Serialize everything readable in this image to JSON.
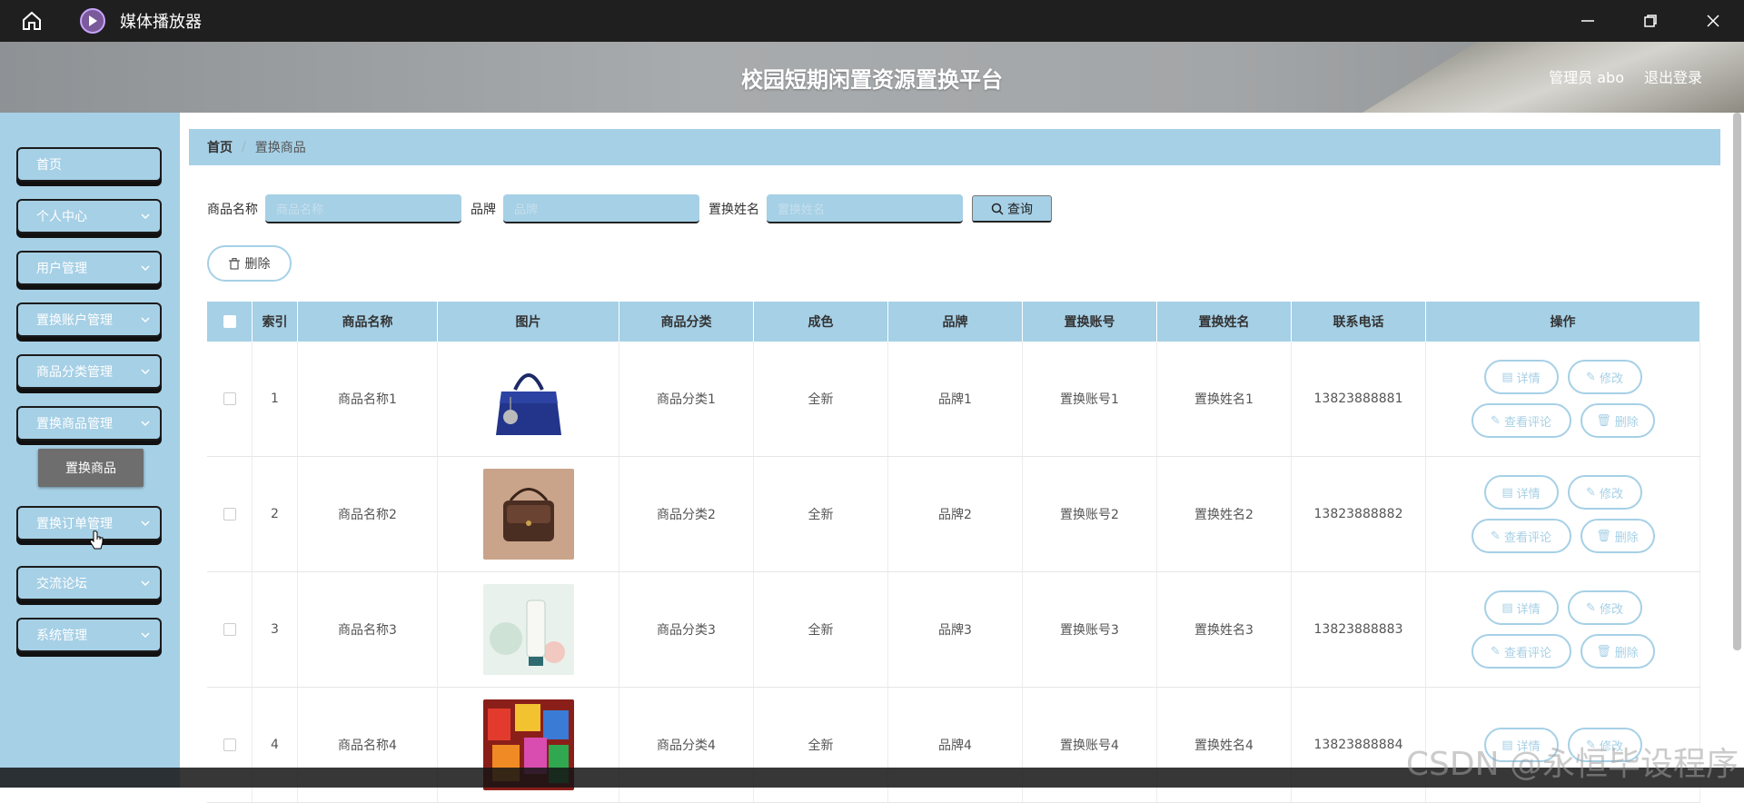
{
  "player": {
    "title": "媒体播放器"
  },
  "header": {
    "site_title": "校园短期闲置资源置换平台",
    "user_label": "管理员 abo",
    "logout_label": "退出登录"
  },
  "sidebar": {
    "items": [
      {
        "label": "首页"
      },
      {
        "label": "个人中心"
      },
      {
        "label": "用户管理"
      },
      {
        "label": "置换账户管理"
      },
      {
        "label": "商品分类管理"
      },
      {
        "label": "置换商品管理"
      },
      {
        "label": "置换订单管理"
      },
      {
        "label": "交流论坛"
      },
      {
        "label": "系统管理"
      }
    ],
    "active_sub": "置换商品"
  },
  "breadcrumb": {
    "home": "首页",
    "separator": "/",
    "current": "置换商品"
  },
  "search": {
    "name_label": "商品名称",
    "name_placeholder": "商品名称",
    "brand_label": "品牌",
    "brand_placeholder": "品牌",
    "person_label": "置换姓名",
    "person_placeholder": "置换姓名",
    "query_label": "查询"
  },
  "toolbar": {
    "delete_label": "删除"
  },
  "table": {
    "headers": [
      "索引",
      "商品名称",
      "图片",
      "商品分类",
      "成色",
      "品牌",
      "置换账号",
      "置换姓名",
      "联系电话",
      "操作"
    ],
    "rows": [
      {
        "index": "1",
        "name": "商品名称1",
        "category": "商品分类1",
        "condition": "全新",
        "brand": "品牌1",
        "account": "置换账号1",
        "person": "置换姓名1",
        "phone": "13823888881",
        "image": "navy-handbag"
      },
      {
        "index": "2",
        "name": "商品名称2",
        "category": "商品分类2",
        "condition": "全新",
        "brand": "品牌2",
        "account": "置换账号2",
        "person": "置换姓名2",
        "phone": "13823888882",
        "image": "brown-crossbody-bag"
      },
      {
        "index": "3",
        "name": "商品名称3",
        "category": "商品分类3",
        "condition": "全新",
        "brand": "品牌3",
        "account": "置换账号3",
        "person": "置换姓名3",
        "phone": "13823888883",
        "image": "cream-tube"
      },
      {
        "index": "4",
        "name": "商品名称4",
        "category": "商品分类4",
        "condition": "全新",
        "brand": "品牌4",
        "account": "置换账号4",
        "person": "置换姓名4",
        "phone": "13823888884",
        "image": "snack-packs"
      }
    ],
    "actions": {
      "detail": "详情",
      "edit": "修改",
      "comments": "查看评论",
      "delete": "删除"
    }
  },
  "watermark": "CSDN @永恒毕设程序",
  "colors": {
    "accent": "#a6d0e6",
    "titlebar": "#1f1f1f"
  }
}
